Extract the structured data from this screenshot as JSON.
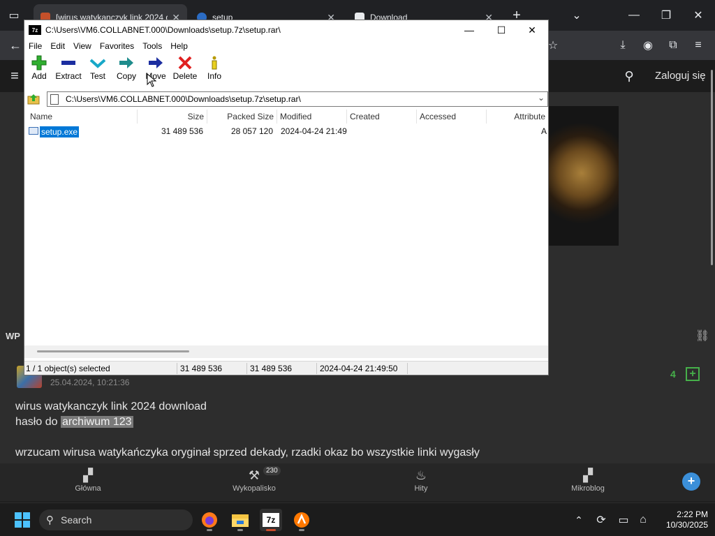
{
  "browser": {
    "tabs": [
      {
        "title": "[wirus watykanczyk link 2024 d"
      },
      {
        "title": "setup"
      },
      {
        "title": "Download"
      }
    ]
  },
  "site": {
    "login": "Zaloguj się",
    "section_label": "WP",
    "post": {
      "date": "25.04.2024, 10:21:36",
      "votes": "4",
      "line1": "wirus watykanczyk link 2024 download",
      "line2_prefix": "hasło do",
      "line2_highlight": "archiwum 123",
      "line3": "wrzucam wirusa watykańczyka oryginał sprzed dekady, rzadki okaz bo wszystkie linki wygasły"
    },
    "bottom_nav": [
      {
        "label": "Główna",
        "icon": "home-icon"
      },
      {
        "label": "Wykopalisko",
        "badge": "230",
        "icon": "shovel-icon"
      },
      {
        "label": "Hity",
        "icon": "fire-icon"
      },
      {
        "label": "Mikroblog",
        "icon": "microblog-icon"
      }
    ]
  },
  "sevenzip": {
    "title": "C:\\Users\\VM6.COLLABNET.000\\Downloads\\setup.7z\\setup.rar\\",
    "menu": [
      "File",
      "Edit",
      "View",
      "Favorites",
      "Tools",
      "Help"
    ],
    "toolbar": [
      "Add",
      "Extract",
      "Test",
      "Copy",
      "Move",
      "Delete",
      "Info"
    ],
    "address": "C:\\Users\\VM6.COLLABNET.000\\Downloads\\setup.7z\\setup.rar\\",
    "columns": [
      "Name",
      "Size",
      "Packed Size",
      "Modified",
      "Created",
      "Accessed",
      "Attribute"
    ],
    "rows": [
      {
        "name": "setup.exe",
        "size": "31 489 536",
        "packed": "28 057 120",
        "modified": "2024-04-24 21:49",
        "created": "",
        "accessed": "",
        "attr": "A"
      }
    ],
    "status": {
      "selected": "1 / 1 object(s) selected",
      "size": "31 489 536",
      "size2": "31 489 536",
      "date": "2024-04-24 21:49:50"
    }
  },
  "taskbar": {
    "search": "Search",
    "time": "2:22 PM",
    "date": "10/30/2025"
  },
  "colors": {
    "selection": "#0078d7",
    "add_green": "#2fae2f",
    "delete_red": "#e02020",
    "arrow_blue": "#1c2ea0"
  }
}
